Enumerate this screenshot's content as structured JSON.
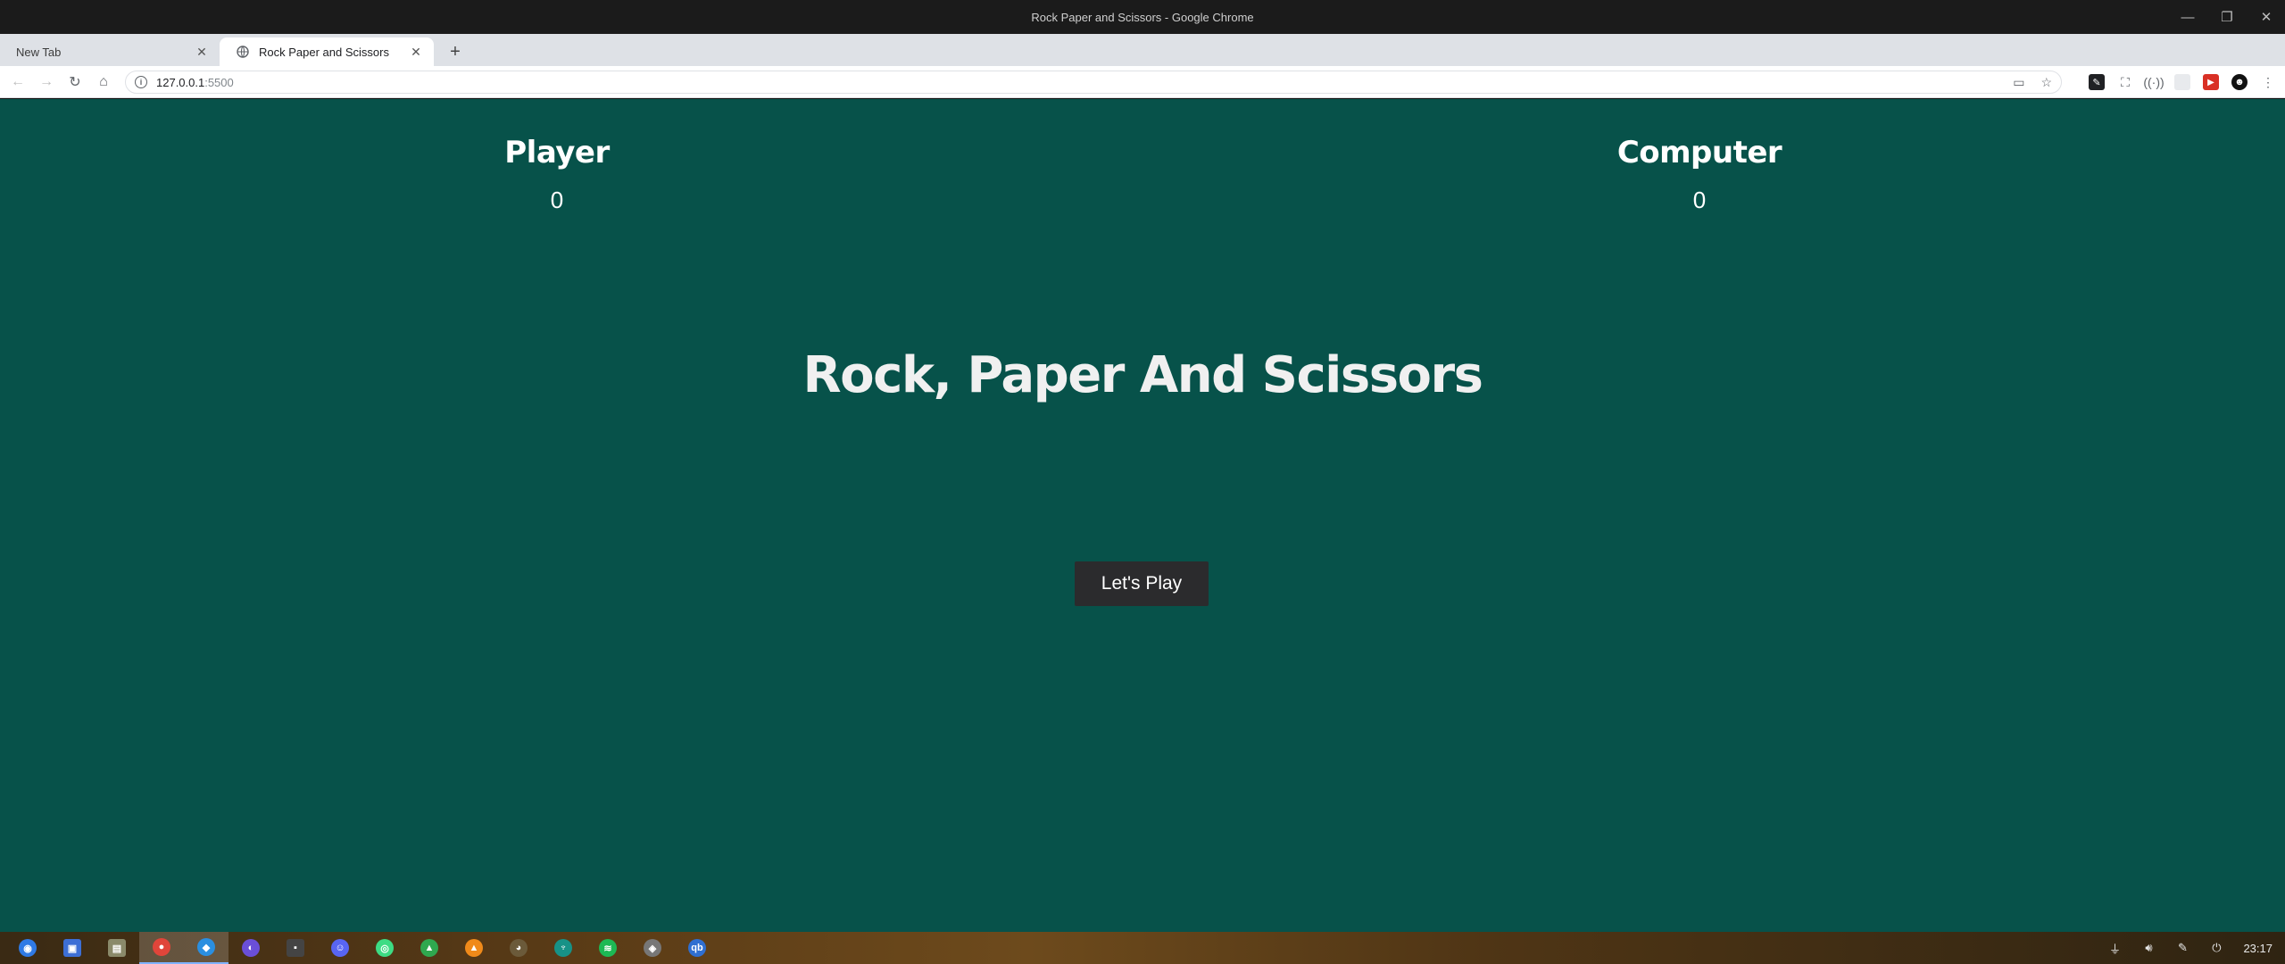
{
  "window": {
    "title": "Rock Paper and Scissors - Google Chrome",
    "controls": {
      "minimize": "—",
      "restore": "❐",
      "close": "✕"
    }
  },
  "tabs": [
    {
      "title": "New Tab",
      "active": false
    },
    {
      "title": "Rock Paper and Scissors",
      "active": true
    }
  ],
  "new_tab_label": "+",
  "toolbar": {
    "back_icon": "←",
    "forward_icon": "→",
    "reload_icon": "↻",
    "home_icon": "⌂",
    "info_icon": "i",
    "url_host": "127.0.0.1",
    "url_port": ":5500",
    "cast_icon": "▭",
    "bookmark_icon": "☆"
  },
  "extensions": [
    "✎",
    "⛶",
    "((·))",
    "",
    "▶",
    "☻",
    "⋮"
  ],
  "page": {
    "player_label": "Player",
    "player_score": "0",
    "computer_label": "Computer",
    "computer_score": "0",
    "title": "Rock, Paper And Scissors",
    "play_button": "Let's Play",
    "background_color": "#07524a"
  },
  "taskbar": {
    "apps": [
      {
        "name": "launcher",
        "glyph": "◉",
        "color": "#2f7ae5"
      },
      {
        "name": "store",
        "glyph": "▣",
        "color": "#3d6fd6"
      },
      {
        "name": "files",
        "glyph": "▤",
        "color": "#8a8a6a"
      },
      {
        "name": "chrome",
        "glyph": "●",
        "color": "#e0453a",
        "active": true
      },
      {
        "name": "vscode",
        "glyph": "◆",
        "color": "#2a8fe0",
        "active": true
      },
      {
        "name": "firefox",
        "glyph": "◐",
        "color": "#6a4fd8"
      },
      {
        "name": "terminal",
        "glyph": "▪",
        "color": "#444"
      },
      {
        "name": "discord",
        "glyph": "☺",
        "color": "#5865f2"
      },
      {
        "name": "android-studio",
        "glyph": "◎",
        "color": "#3ddc84"
      },
      {
        "name": "image-viewer",
        "glyph": "▲",
        "color": "#2fa84f"
      },
      {
        "name": "vlc",
        "glyph": "▲",
        "color": "#f08a1a"
      },
      {
        "name": "gimp",
        "glyph": "◕",
        "color": "#6b5a3a"
      },
      {
        "name": "gitkraken",
        "glyph": "♆",
        "color": "#179287"
      },
      {
        "name": "spotify",
        "glyph": "≋",
        "color": "#1db954"
      },
      {
        "name": "layers",
        "glyph": "◈",
        "color": "#777"
      },
      {
        "name": "qbittorrent",
        "glyph": "qb",
        "color": "#2f6fd1"
      }
    ],
    "time": "23:17"
  }
}
